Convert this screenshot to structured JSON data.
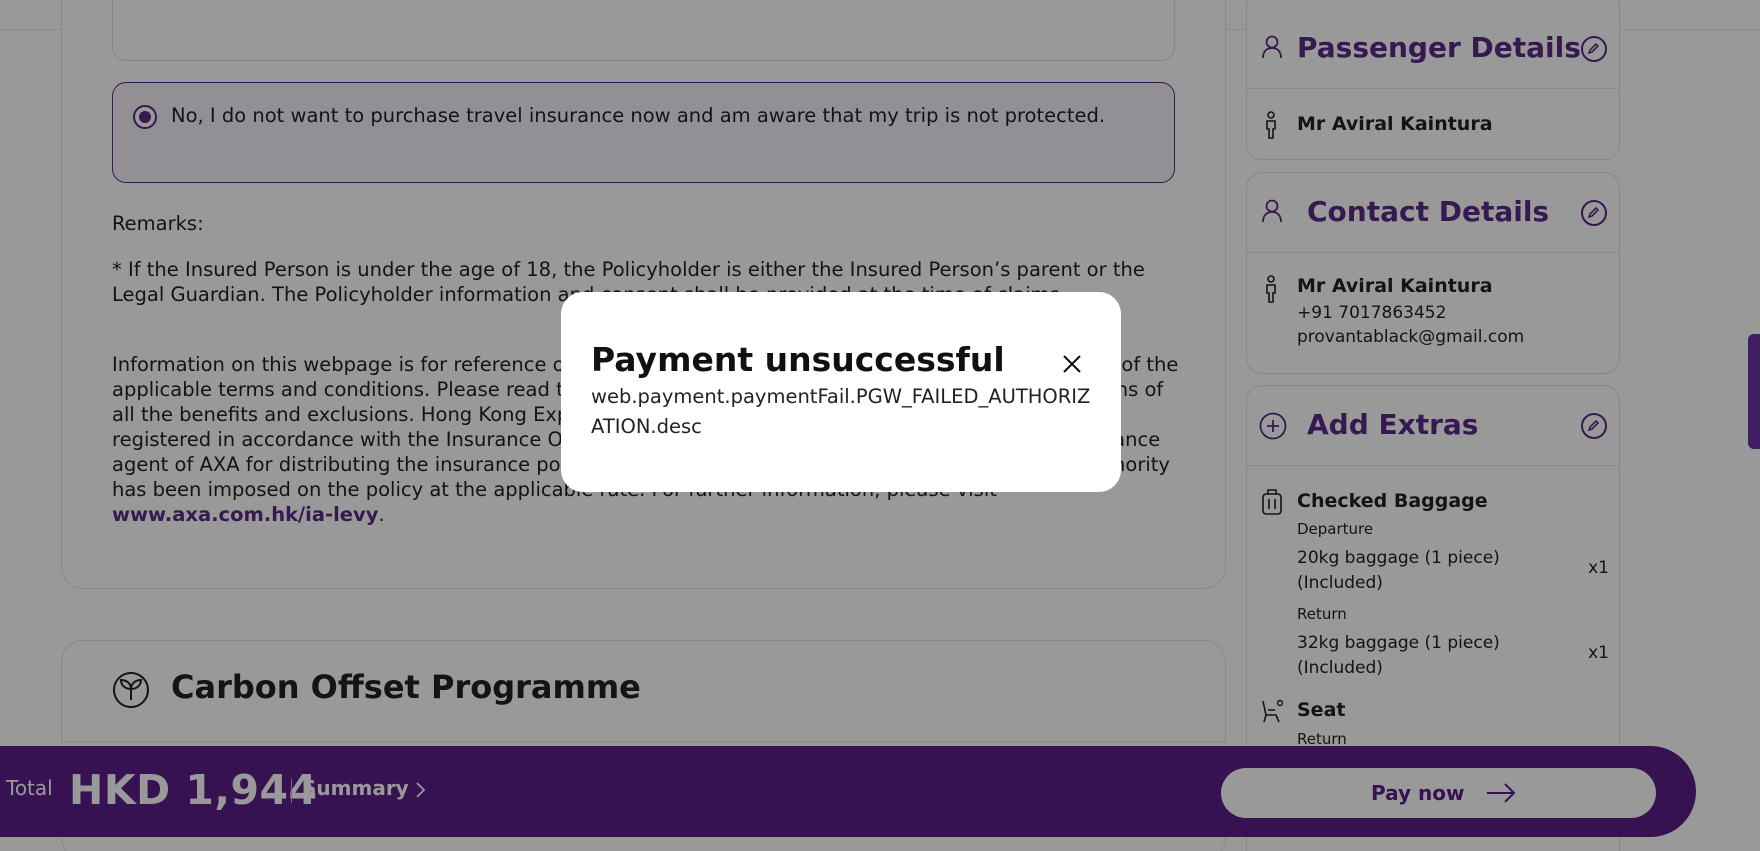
{
  "insurance": {
    "option_no_label": "No, I do not want to purchase travel insurance now and am aware that my trip is not protected.",
    "remarks_title": "Remarks:",
    "remark_1": "* If the Insured Person is under the age of 18, the Policyholder is either the Insured Person’s parent or the Legal Guardian. The Policyholder information and consent shall be provided at the time of claims.",
    "remark_2_text": "Information on this webpage is for reference only. Please refer to the policy wording for full description of the applicable terms and conditions. Please read the policy wording carefully for all the terms and conditions of all the benefits and exclusions. Hong Kong Express Airways Limited (Insurance Agent No. FA2201) is registered in accordance with the Insurance Ordinance (Cap. 41 of the Laws of Hong Kong) as an insurance agent of AXA for distributing the insurance policy. The levy collected on behalf of by the Insurance Authority has been imposed on the policy at the applicable rate. For further information, please visit",
    "remark_2_link": "www.axa.com.hk/ia-levy",
    "remark_2_end": "."
  },
  "carbon": {
    "title": "Carbon Offset Programme",
    "icon": "leaf-icon"
  },
  "sidebar": {
    "passenger": {
      "title": "Passenger Details",
      "name": "Mr Aviral Kaintura"
    },
    "contact": {
      "title": "Contact Details",
      "name": "Mr Aviral Kaintura",
      "phone": "+91 7017863452",
      "email": "provantablack@gmail.com"
    },
    "extras": {
      "title": "Add Extras",
      "baggage_title": "Checked Baggage",
      "departure_label": "Departure",
      "departure_item_line1": "20kg baggage (1 piece)",
      "departure_item_line2": "(Included)",
      "departure_qty": "x1",
      "return_label": "Return",
      "return_item_line1": "32kg baggage (1 piece)",
      "return_item_line2": "(Included)",
      "return_qty": "x1",
      "seat_title": "Seat",
      "seat_return_label": "Return"
    }
  },
  "bottom_bar": {
    "total_label": "Total",
    "total_value": "HKD 1,944",
    "summary_label": "Summary",
    "pay_label": "Pay now"
  },
  "modal": {
    "title": "Payment unsuccessful",
    "description": "web.payment.paymentFail.PGW_FAILED_AUTHORIZATION.desc"
  },
  "colors": {
    "brand_purple": "#5a1f8a",
    "overlay": "rgba(0,0,0,0.40)"
  }
}
